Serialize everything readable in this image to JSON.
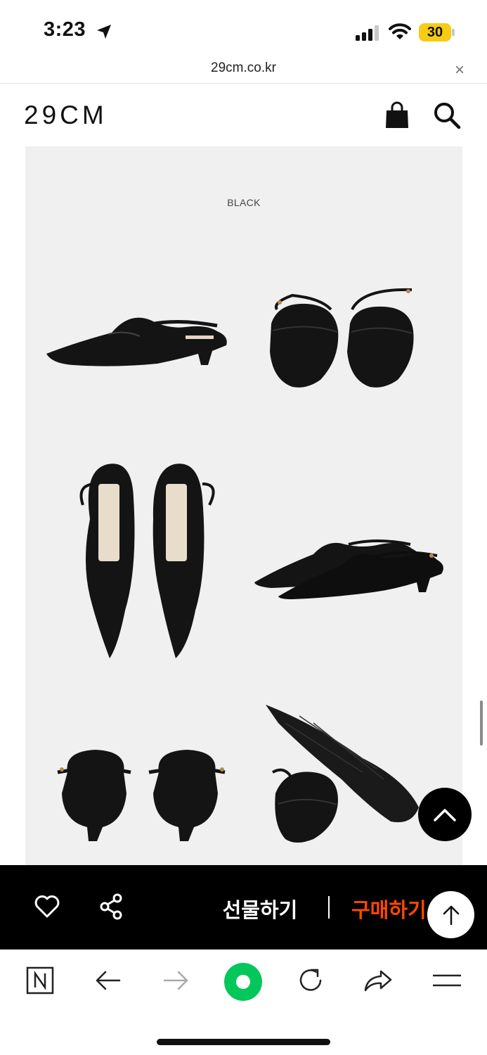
{
  "status_bar": {
    "time": "3:23",
    "battery": "30"
  },
  "browser": {
    "url": "29cm.co.kr",
    "close_symbol": "×"
  },
  "site": {
    "logo": "29CM"
  },
  "product": {
    "color_label": "BLACK"
  },
  "action_bar": {
    "gift_label": "선물하기",
    "buy_label": "구매하기"
  },
  "colors": {
    "accent": "#ff4800",
    "action_bar_bg": "#000000",
    "panel_bg": "#f0f0f0",
    "naver_green": "#03c75a"
  },
  "icons": [
    "location-arrow-icon",
    "signal-icon",
    "wifi-icon",
    "shopping-bag-icon",
    "search-icon",
    "chevron-up-icon",
    "heart-icon",
    "share-icon",
    "arrow-up-icon",
    "naver-n-icon",
    "back-arrow-icon",
    "forward-arrow-icon",
    "green-dot-icon",
    "reload-icon",
    "share-arrow-icon",
    "menu-icon"
  ]
}
